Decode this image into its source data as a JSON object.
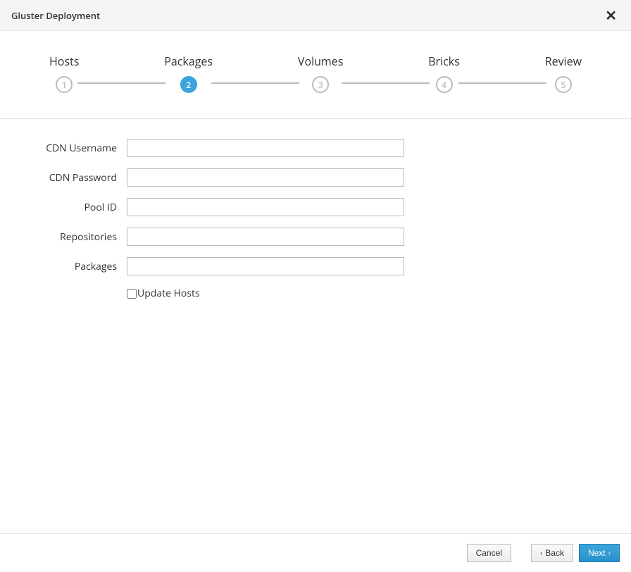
{
  "header": {
    "title": "Gluster Deployment"
  },
  "wizard": {
    "steps": [
      {
        "num": "1",
        "label": "Hosts"
      },
      {
        "num": "2",
        "label": "Packages"
      },
      {
        "num": "3",
        "label": "Volumes"
      },
      {
        "num": "4",
        "label": "Bricks"
      },
      {
        "num": "5",
        "label": "Review"
      }
    ],
    "active_index": 1
  },
  "form": {
    "cdn_username": {
      "label": "CDN Username",
      "value": ""
    },
    "cdn_password": {
      "label": "CDN Password",
      "value": ""
    },
    "pool_id": {
      "label": "Pool ID",
      "value": ""
    },
    "repositories": {
      "label": "Repositories",
      "value": ""
    },
    "packages": {
      "label": "Packages",
      "value": ""
    },
    "update_hosts": {
      "label": "Update Hosts",
      "checked": false
    }
  },
  "footer": {
    "cancel": "Cancel",
    "back": "Back",
    "next": "Next"
  }
}
